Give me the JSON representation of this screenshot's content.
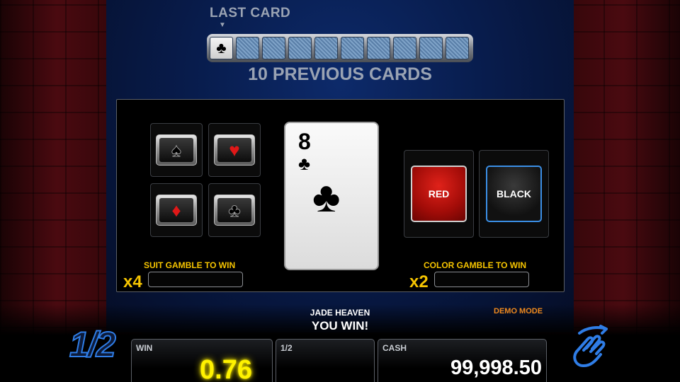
{
  "header": {
    "last_card_label": "LAST CARD",
    "previous_cards_label": "10 PREVIOUS CARDS",
    "last_card_suit": "♣",
    "hidden_card_count": 9
  },
  "suit_gamble": {
    "suits": [
      {
        "name": "spades",
        "glyph": "♠",
        "color": "#000000"
      },
      {
        "name": "hearts",
        "glyph": "♥",
        "color": "#e01818"
      },
      {
        "name": "diamonds",
        "glyph": "♦",
        "color": "#e01818"
      },
      {
        "name": "clubs",
        "glyph": "♣",
        "color": "#000000"
      }
    ],
    "label": "SUIT GAMBLE TO WIN",
    "multiplier": "x4",
    "value": ""
  },
  "current_card": {
    "rank": "8",
    "suit": "♣"
  },
  "color_gamble": {
    "red_label": "RED",
    "black_label": "BLACK",
    "label": "COLOR GAMBLE TO WIN",
    "multiplier": "x2",
    "value": ""
  },
  "status": {
    "game_name": "JADE HEAVEN",
    "message": "YOU WIN!",
    "mode": "DEMO MODE"
  },
  "footer": {
    "half_button_label": "1/2",
    "win_title": "WIN",
    "win_value": "0.76",
    "half_title": "1/2",
    "half_value": "",
    "cash_title": "CASH",
    "cash_value": "99,998.50"
  },
  "colors": {
    "accent_yellow": "#f5c400",
    "demo_orange": "#f08a1e",
    "win_yellow": "#fff200",
    "blue_accent": "#2f7de6"
  }
}
